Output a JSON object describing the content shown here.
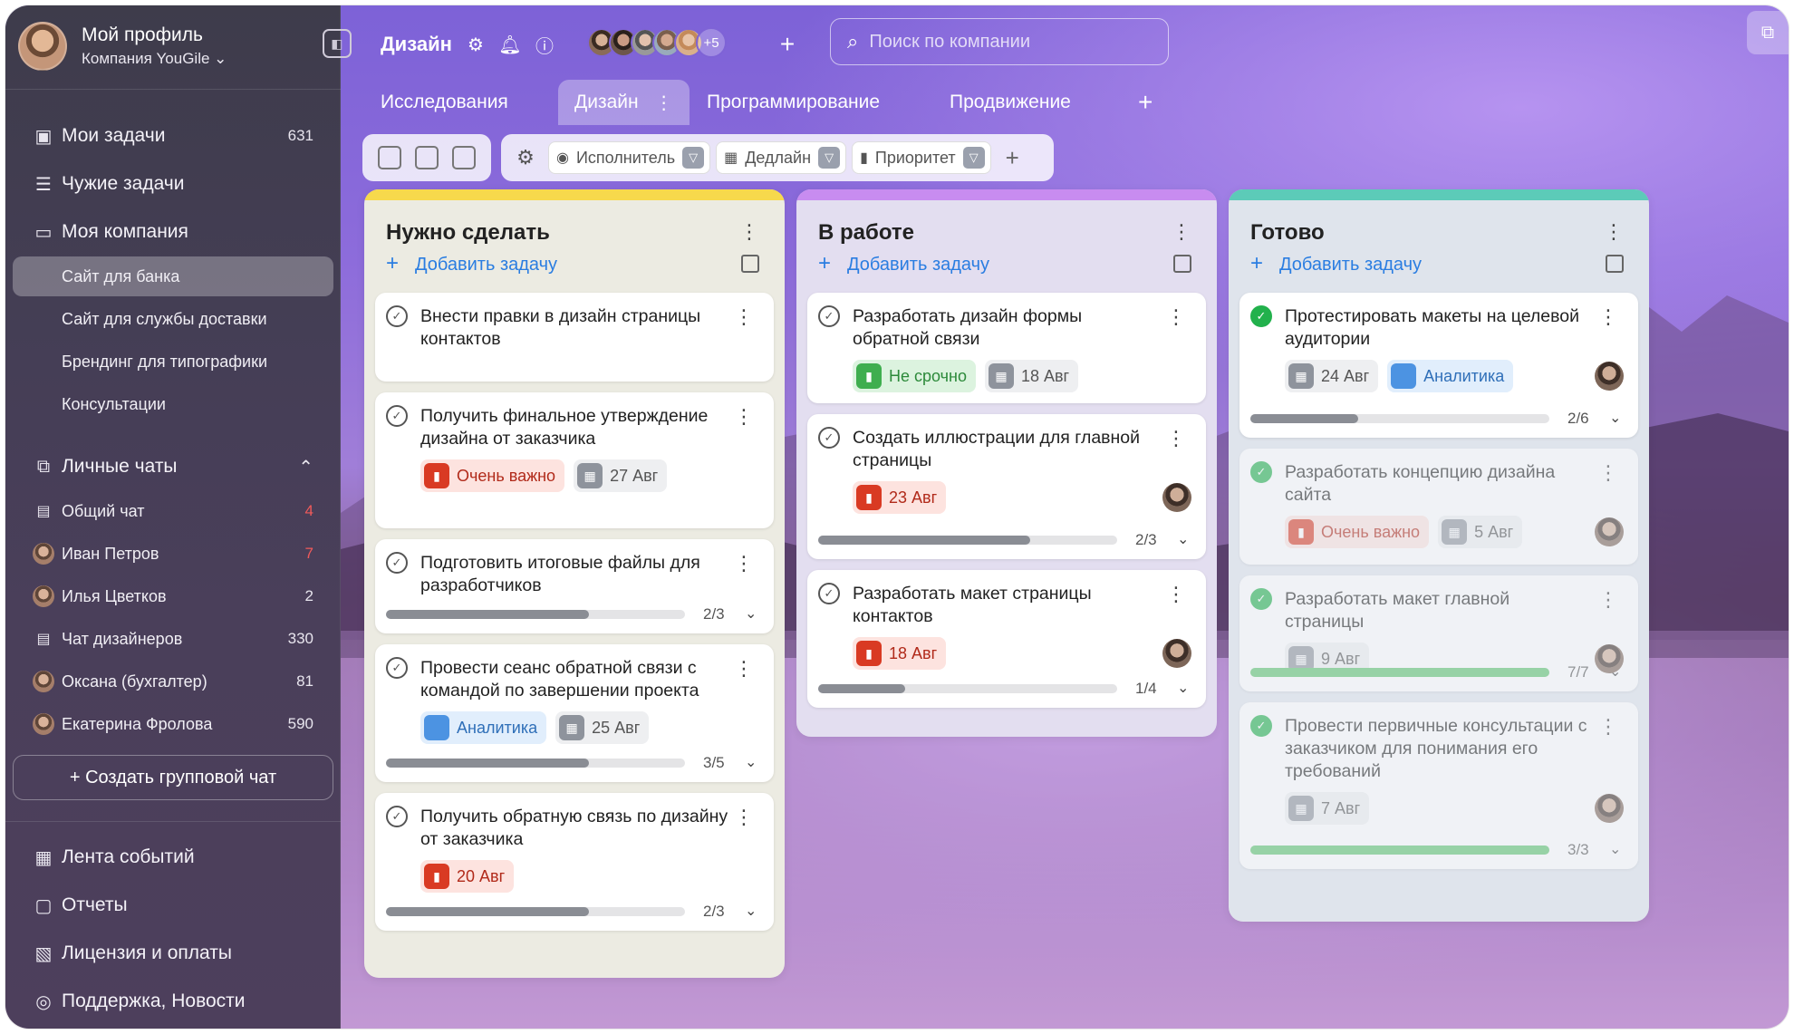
{
  "sidebar": {
    "profile": {
      "name": "Мой профиль",
      "company": "Компания YouGile"
    },
    "main_nav": [
      {
        "label": "Мои задачи",
        "count": "631",
        "icon": "my-tasks-icon"
      },
      {
        "label": "Чужие задачи",
        "count": "",
        "icon": "list-icon"
      },
      {
        "label": "Моя компания",
        "count": "",
        "icon": "briefcase-icon"
      }
    ],
    "projects": [
      {
        "label": "Сайт для банка",
        "active": true
      },
      {
        "label": "Сайт для службы доставки",
        "active": false
      },
      {
        "label": "Брендинг для типографики",
        "active": false
      },
      {
        "label": "Консультации",
        "active": false
      }
    ],
    "chats_header": "Личные чаты",
    "chats": [
      {
        "label": "Общий чат",
        "count": "4",
        "red": true
      },
      {
        "label": "Иван Петров",
        "count": "7",
        "red": true
      },
      {
        "label": "Илья Цветков",
        "count": "2",
        "red": false
      },
      {
        "label": "Чат дизайнеров",
        "count": "330",
        "red": false
      },
      {
        "label": "Оксана (бухгалтер)",
        "count": "81",
        "red": false
      },
      {
        "label": "Екатерина Фролова",
        "count": "590",
        "red": false
      }
    ],
    "create_chat": "+ Создать групповой чат",
    "bottom_nav": [
      {
        "label": "Лента событий",
        "icon": "event-feed-icon"
      },
      {
        "label": "Отчеты",
        "icon": "reports-icon"
      },
      {
        "label": "Лицензия и оплаты",
        "icon": "license-icon"
      },
      {
        "label": "Поддержка, Новости",
        "icon": "support-icon"
      }
    ]
  },
  "topbar": {
    "project_title": "Дизайн",
    "more_members": "+5",
    "search_placeholder": "Поиск по компании"
  },
  "tabs": [
    {
      "label": "Исследования",
      "active": false
    },
    {
      "label": "Дизайн",
      "active": true
    },
    {
      "label": "Программирование",
      "active": false
    },
    {
      "label": "Продвижение",
      "active": false
    }
  ],
  "filters": [
    {
      "label": "Исполнитель",
      "icon": "user-icon"
    },
    {
      "label": "Дедлайн",
      "icon": "calendar-icon"
    },
    {
      "label": "Приоритет",
      "icon": "priority-icon"
    }
  ],
  "colors": {
    "todo_stripe": "#f7d94c",
    "todo_bg": "#ecebe2",
    "progress_stripe": "#c88cf0",
    "progress_bg": "#e3def0",
    "done_stripe": "#5ccbb8",
    "done_bg": "#dfe4ec",
    "accent": "#2a7de1"
  },
  "columns": [
    {
      "title": "Нужно сделать",
      "add_label": "Добавить задачу",
      "cards": [
        {
          "title": "Внести правки в дизайн страницы контактов"
        },
        {
          "title": "Получить финальное утверждение дизайна от заказчика",
          "badges": [
            {
              "type": "red",
              "text": "Очень важно"
            },
            {
              "type": "gray",
              "text": "27 Авг"
            }
          ]
        },
        {
          "title": "Подготовить итоговые файлы для разработчиков",
          "progress": "2/3",
          "progress_value": 0.68
        },
        {
          "title": "Провести сеанс обратной связи с командой по завершении проекта",
          "badges": [
            {
              "type": "blue",
              "text": "Аналитика"
            },
            {
              "type": "gray",
              "text": "25 Авг"
            }
          ],
          "progress": "3/5",
          "progress_value": 0.68
        },
        {
          "title": "Получить обратную связь по дизайну от заказчика",
          "badges": [
            {
              "type": "red",
              "text": "20 Авг"
            }
          ],
          "progress": "2/3",
          "progress_value": 0.68
        }
      ]
    },
    {
      "title": "В работе",
      "add_label": "Добавить задачу",
      "cards": [
        {
          "title": "Разработать дизайн формы обратной связи",
          "badges": [
            {
              "type": "green",
              "text": "Не срочно"
            },
            {
              "type": "gray",
              "text": "18 Авг"
            }
          ]
        },
        {
          "title": "Создать иллюстрации для главной страницы",
          "badges": [
            {
              "type": "red",
              "text": "23 Авг"
            }
          ],
          "progress": "2/3",
          "progress_value": 0.71
        },
        {
          "title": "Разработать макет страницы контактов",
          "badges": [
            {
              "type": "red",
              "text": "18 Авг"
            }
          ],
          "progress": "1/4",
          "progress_value": 0.29
        }
      ]
    },
    {
      "title": "Готово",
      "add_label": "Добавить задачу",
      "cards": [
        {
          "title": "Протестировать макеты на целевой аудитории",
          "badges": [
            {
              "type": "gray",
              "text": "24 Авг"
            },
            {
              "type": "blue",
              "text": "Аналитика"
            }
          ],
          "progress": "2/6",
          "progress_value": 0.36
        },
        {
          "title": "Разработать концепцию дизайна сайта",
          "badges": [
            {
              "type": "red",
              "text": "Очень важно"
            },
            {
              "type": "gray",
              "text": "5 Авг"
            }
          ]
        },
        {
          "title": "Разработать макет главной страницы",
          "badges": [
            {
              "type": "gray",
              "text": "9 Авг"
            }
          ],
          "progress": "7/7",
          "progress_value": 1.0
        },
        {
          "title": "Провести первичные консультации с заказчиком для понимания его требований",
          "badges": [
            {
              "type": "gray",
              "text": "7 Авг"
            }
          ],
          "progress": "3/3",
          "progress_value": 1.0
        }
      ]
    }
  ]
}
